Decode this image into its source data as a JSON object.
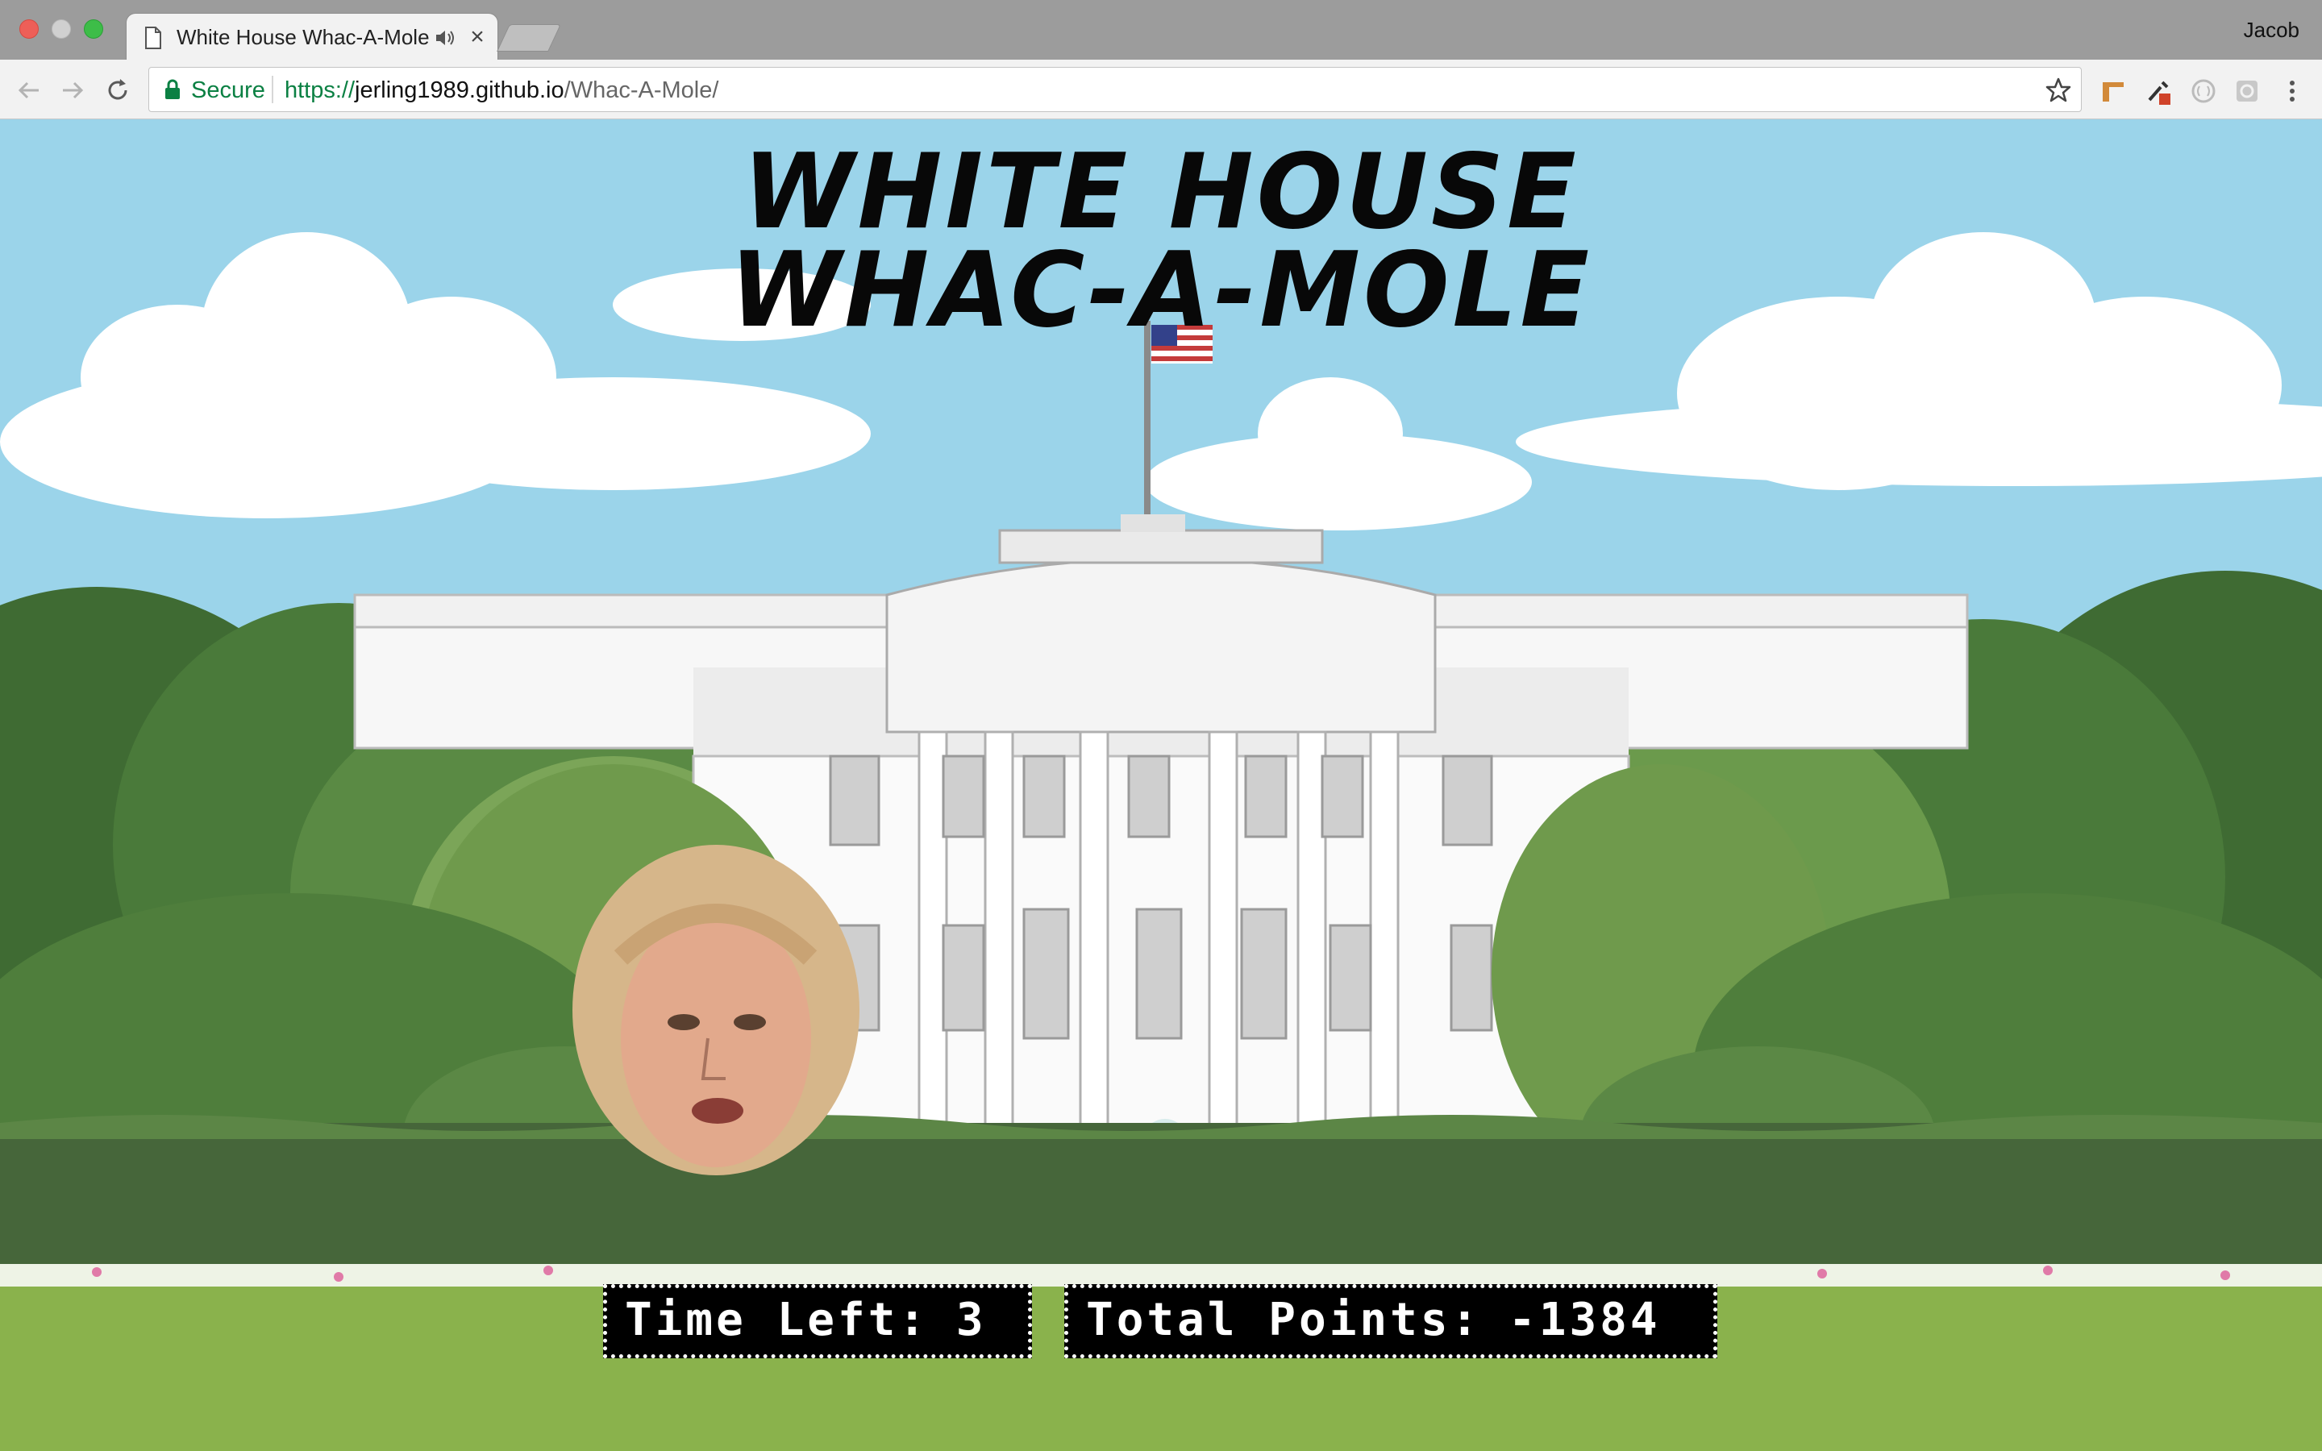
{
  "browser": {
    "tab": {
      "title": "White House Whac-A-Mole",
      "close_glyph": "×"
    },
    "profile_name": "Jacob",
    "address_bar": {
      "security_label": "Secure",
      "url_scheme": "https://",
      "url_host": "jerling1989.github.io",
      "url_path": "/Whac-A-Mole/"
    },
    "icons": [
      "back-icon",
      "forward-icon",
      "reload-icon",
      "lock-icon",
      "bookmark-star-icon",
      "extension-icons"
    ]
  },
  "game": {
    "title_line1": "WHITE HOUSE",
    "title_line2": "WHAC-A-MOLE",
    "time_left_label": "Time Left:",
    "time_left_value": "3",
    "points_label": "Total Points:",
    "points_value": "-1384"
  },
  "colors": {
    "sky": "#9bd4ea",
    "hedge": "#46663a",
    "lawn": "#8ab24c",
    "secure_green": "#0b8043",
    "hud_bg": "#000000",
    "hud_text": "#ffffff"
  }
}
